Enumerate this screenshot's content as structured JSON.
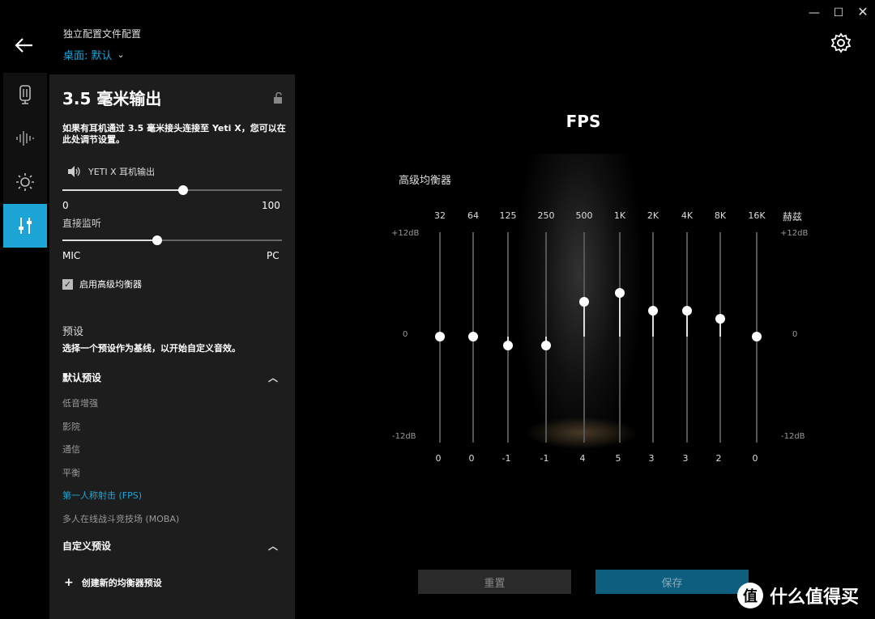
{
  "window": {
    "minimize": "—",
    "maximize": "☐",
    "close": "✕"
  },
  "header": {
    "profile_title": "独立配置文件配置",
    "profile_name": "桌面: 默认",
    "back_icon": "back-arrow-icon",
    "settings_icon": "gear-icon"
  },
  "rail": [
    {
      "icon": "microphone-device-icon",
      "active": false
    },
    {
      "icon": "waveform-icon",
      "active": false
    },
    {
      "icon": "brightness-icon",
      "active": false
    },
    {
      "icon": "equalizer-icon",
      "active": true
    }
  ],
  "panel": {
    "title": "3.5 毫米输出",
    "description": "如果有耳机通过 3.5 毫米接头连接至 Yeti X，您可以在此处调节设置。",
    "headphone_label": "YETI X 耳机输出",
    "volume": {
      "min_label": "0",
      "max_label": "100",
      "value": 0.55
    },
    "monitor_label": "直接监听",
    "monitor": {
      "left_label": "MIC",
      "right_label": "PC",
      "value": 0.43
    },
    "advanced_eq_label": "启用高级均衡器",
    "advanced_eq_checked": true,
    "presets_label": "预设",
    "presets_desc": "选择一个预设作为基线，以开始自定义音效。",
    "default_presets_title": "默认预设",
    "default_presets": [
      "低音增强",
      "影院",
      "通信",
      "平衡",
      "第一人称射击 (FPS)",
      "多人在线战斗竞技场 (MOBA)"
    ],
    "active_preset_index": 4,
    "custom_presets_title": "自定义预设",
    "create_label": "创建新的均衡器预设"
  },
  "eq": {
    "title": "FPS",
    "label": "高级均衡器",
    "unit": "赫兹",
    "db_top": "+12dB",
    "db_mid": "0",
    "db_bottom": "-12dB",
    "bands": [
      {
        "freq": "32",
        "value": 0
      },
      {
        "freq": "64",
        "value": 0
      },
      {
        "freq": "125",
        "value": -1
      },
      {
        "freq": "250",
        "value": -1
      },
      {
        "freq": "500",
        "value": 4
      },
      {
        "freq": "1K",
        "value": 5
      },
      {
        "freq": "2K",
        "value": 3
      },
      {
        "freq": "4K",
        "value": 3
      },
      {
        "freq": "8K",
        "value": 2
      },
      {
        "freq": "16K",
        "value": 0
      }
    ]
  },
  "buttons": {
    "reset": "重置",
    "save": "保存"
  },
  "watermark": {
    "logo": "值",
    "text": "什么值得买"
  }
}
